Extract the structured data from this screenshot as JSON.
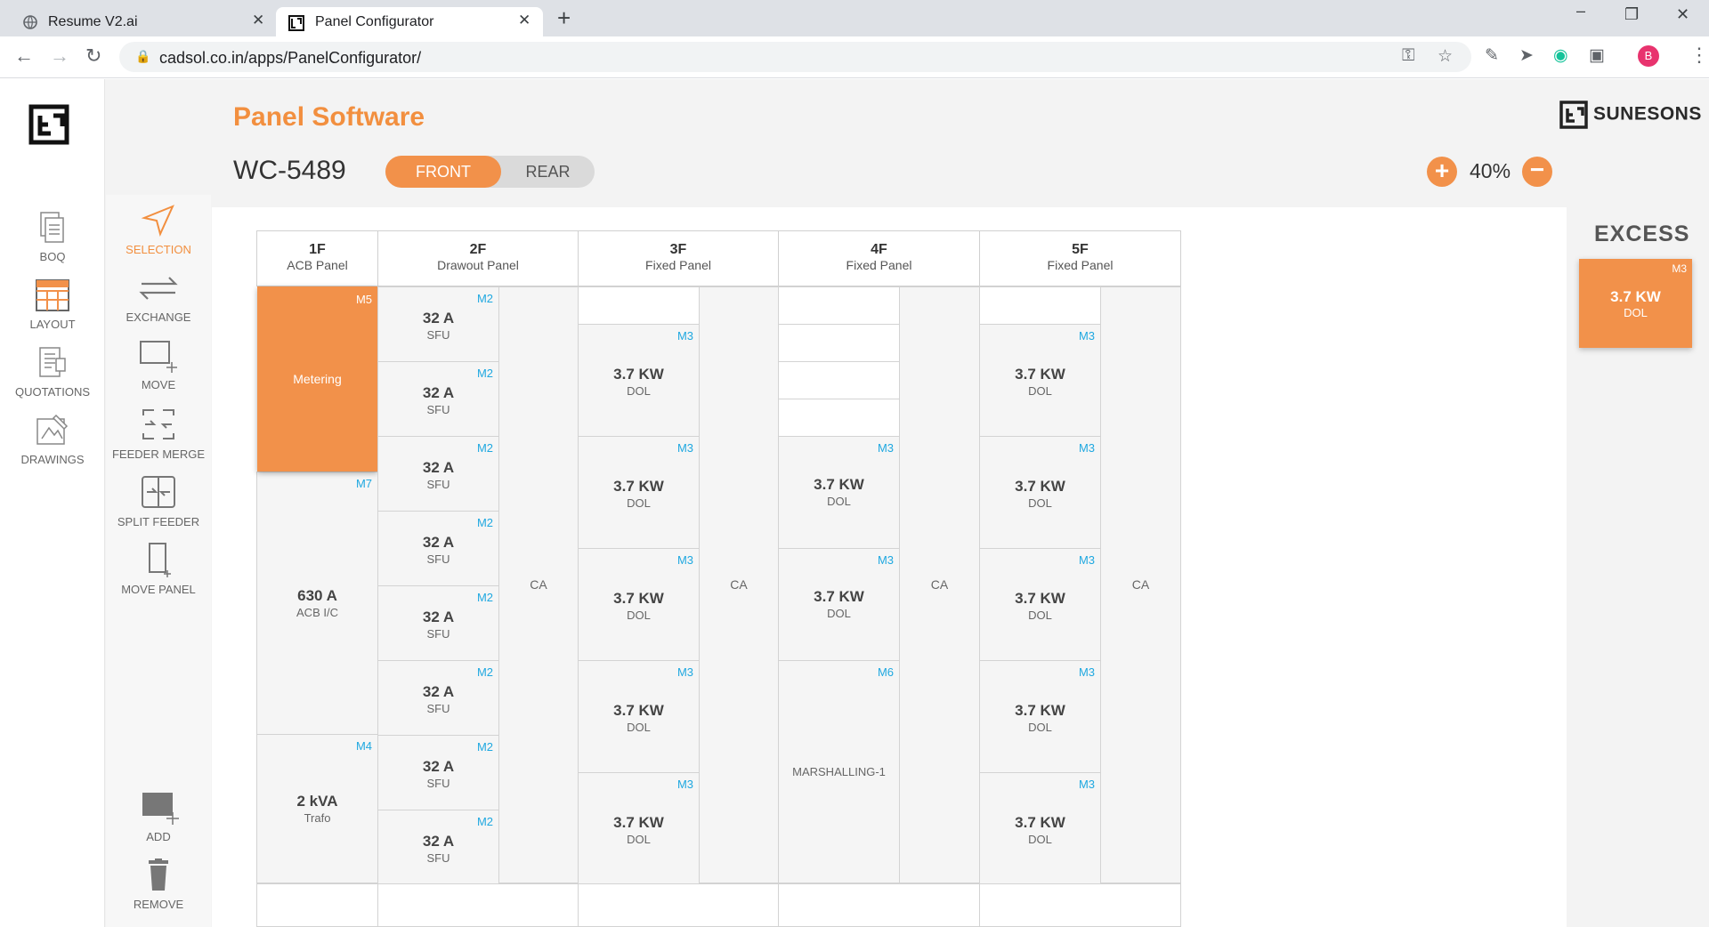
{
  "browser": {
    "tabs": [
      {
        "title": "Resume V2.ai"
      },
      {
        "title": "Panel Configurator"
      }
    ],
    "url": "cadsol.co.in/apps/PanelConfigurator/",
    "profile_initial": "B"
  },
  "app": {
    "title": "Panel Software",
    "brand": "SUNESONS",
    "panel_id": "WC-5489",
    "view_toggle": {
      "front": "FRONT",
      "rear": "REAR",
      "selected": "FRONT"
    },
    "zoom": "40%",
    "left_nav": [
      {
        "label": "BOQ",
        "icon": "boq-icon"
      },
      {
        "label": "LAYOUT",
        "icon": "layout-icon"
      },
      {
        "label": "QUOTATIONS",
        "icon": "quotations-icon"
      },
      {
        "label": "DRAWINGS",
        "icon": "drawings-icon"
      }
    ],
    "tools": [
      {
        "label": "SELECTION",
        "icon": "selection-icon",
        "active": true
      },
      {
        "label": "EXCHANGE",
        "icon": "exchange-icon"
      },
      {
        "label": "MOVE",
        "icon": "move-icon"
      },
      {
        "label": "FEEDER MERGE",
        "icon": "feeder-merge-icon"
      },
      {
        "label": "SPLIT FEEDER",
        "icon": "split-feeder-icon"
      },
      {
        "label": "MOVE PANEL",
        "icon": "move-panel-icon"
      }
    ],
    "bottom_tools": [
      {
        "label": "ADD",
        "icon": "add-icon"
      },
      {
        "label": "REMOVE",
        "icon": "trash-icon"
      }
    ],
    "excess": {
      "label": "EXCESS",
      "card": {
        "module": "M3",
        "value": "3.7 KW",
        "sub": "DOL"
      }
    },
    "colors": {
      "accent": "#f2914a",
      "module_tag": "#1fa8e0"
    }
  },
  "panels": [
    {
      "num": "1F",
      "type": "ACB Panel",
      "metering": {
        "module": "M5",
        "label": "Metering"
      },
      "feeders": [
        {
          "module": "M7",
          "value": "630 A",
          "sub": "ACB I/C"
        },
        {
          "module": "M4",
          "value": "2 kVA",
          "sub": "Trafo"
        }
      ]
    },
    {
      "num": "2F",
      "type": "Drawout Panel",
      "ca": "CA",
      "feeders": [
        {
          "module": "M2",
          "value": "32 A",
          "sub": "SFU"
        },
        {
          "module": "M2",
          "value": "32 A",
          "sub": "SFU"
        },
        {
          "module": "M2",
          "value": "32 A",
          "sub": "SFU"
        },
        {
          "module": "M2",
          "value": "32 A",
          "sub": "SFU"
        },
        {
          "module": "M2",
          "value": "32 A",
          "sub": "SFU"
        },
        {
          "module": "M2",
          "value": "32 A",
          "sub": "SFU"
        },
        {
          "module": "M2",
          "value": "32 A",
          "sub": "SFU"
        },
        {
          "module": "M2",
          "value": "32 A",
          "sub": "SFU"
        }
      ]
    },
    {
      "num": "3F",
      "type": "Fixed Panel",
      "ca": "CA",
      "feeders": [
        {
          "module": "M3",
          "value": "3.7 KW",
          "sub": "DOL"
        },
        {
          "module": "M3",
          "value": "3.7 KW",
          "sub": "DOL"
        },
        {
          "module": "M3",
          "value": "3.7 KW",
          "sub": "DOL"
        },
        {
          "module": "M3",
          "value": "3.7 KW",
          "sub": "DOL"
        },
        {
          "module": "M3",
          "value": "3.7 KW",
          "sub": "DOL"
        }
      ]
    },
    {
      "num": "4F",
      "type": "Fixed Panel",
      "ca": "CA",
      "feeders": [
        {
          "module": "M3",
          "value": "3.7 KW",
          "sub": "DOL"
        },
        {
          "module": "M3",
          "value": "3.7 KW",
          "sub": "DOL"
        },
        {
          "module": "M6",
          "value": "",
          "sub": "MARSHALLING-1"
        }
      ]
    },
    {
      "num": "5F",
      "type": "Fixed Panel",
      "ca": "CA",
      "feeders": [
        {
          "module": "M3",
          "value": "3.7 KW",
          "sub": "DOL"
        },
        {
          "module": "M3",
          "value": "3.7 KW",
          "sub": "DOL"
        },
        {
          "module": "M3",
          "value": "3.7 KW",
          "sub": "DOL"
        },
        {
          "module": "M3",
          "value": "3.7 KW",
          "sub": "DOL"
        },
        {
          "module": "M3",
          "value": "3.7 KW",
          "sub": "DOL"
        }
      ]
    }
  ]
}
